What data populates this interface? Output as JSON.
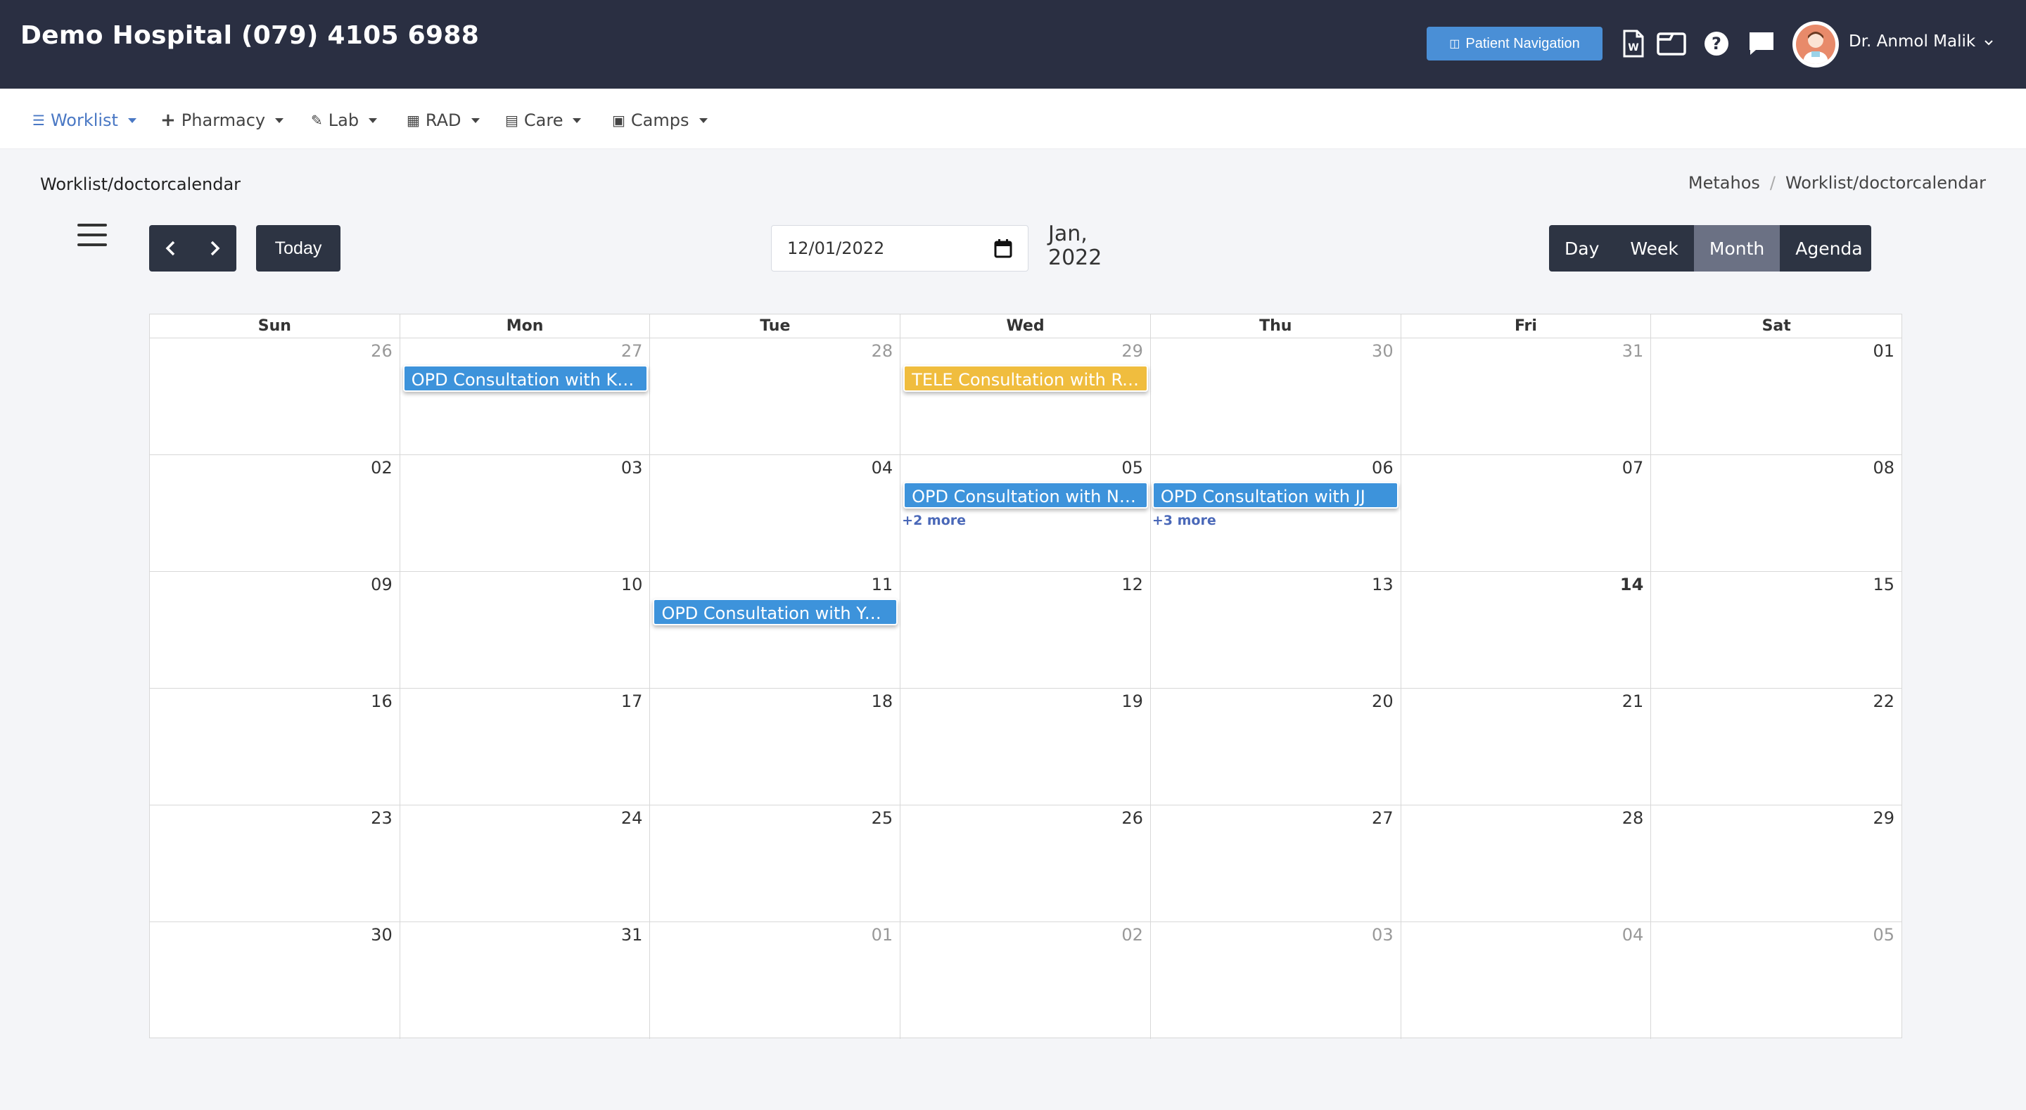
{
  "header": {
    "title": "Demo Hospital (079) 4105 6988",
    "patient_nav_label": "Patient Navigation",
    "user_name": "Dr. Anmol Malik"
  },
  "menu": [
    {
      "label": "Worklist",
      "icon": "list-icon"
    },
    {
      "label": "Pharmacy",
      "icon": "plus-icon"
    },
    {
      "label": "Lab",
      "icon": "pencil-icon"
    },
    {
      "label": "RAD",
      "icon": "film-icon"
    },
    {
      "label": "Care",
      "icon": "bed-icon"
    },
    {
      "label": "Camps",
      "icon": "briefcase-icon"
    }
  ],
  "breadcrumb": {
    "page": "Worklist/doctorcalendar",
    "root": "Metahos",
    "sep": "/",
    "current": "Worklist/doctorcalendar"
  },
  "toolbar": {
    "today_label": "Today",
    "date_value": "12/01/2022",
    "month_label": "Jan, 2022",
    "views": [
      "Day",
      "Week",
      "Month",
      "Agenda"
    ],
    "active_view": "Month"
  },
  "calendar": {
    "weekdays": [
      "Sun",
      "Mon",
      "Tue",
      "Wed",
      "Thu",
      "Fri",
      "Sat"
    ],
    "weeks": [
      [
        "26",
        "27",
        "28",
        "29",
        "30",
        "31",
        "01"
      ],
      [
        "02",
        "03",
        "04",
        "05",
        "06",
        "07",
        "08"
      ],
      [
        "09",
        "10",
        "11",
        "12",
        "13",
        "14",
        "15"
      ],
      [
        "16",
        "17",
        "18",
        "19",
        "20",
        "21",
        "22"
      ],
      [
        "23",
        "24",
        "25",
        "26",
        "27",
        "28",
        "29"
      ],
      [
        "30",
        "31",
        "01",
        "02",
        "03",
        "04",
        "05"
      ]
    ],
    "events": [
      {
        "label": "OPD Consultation with Kris...",
        "type": "opd"
      },
      {
        "label": "TELE Consultation with Rek...",
        "type": "tele"
      },
      {
        "label": "OPD Consultation with Nish...",
        "type": "opd"
      },
      {
        "label": "OPD Consultation with JJ",
        "type": "opd"
      },
      {
        "label": "OPD Consultation with Yell...",
        "type": "opd"
      }
    ],
    "more_links": [
      "+2 more",
      "+3 more"
    ]
  },
  "colors": {
    "header_bg": "#2a2f42",
    "accent": "#4a8fd6",
    "opd_event": "#3d93db",
    "tele_event": "#f0bd3e",
    "active_menu": "#4a78c4"
  }
}
